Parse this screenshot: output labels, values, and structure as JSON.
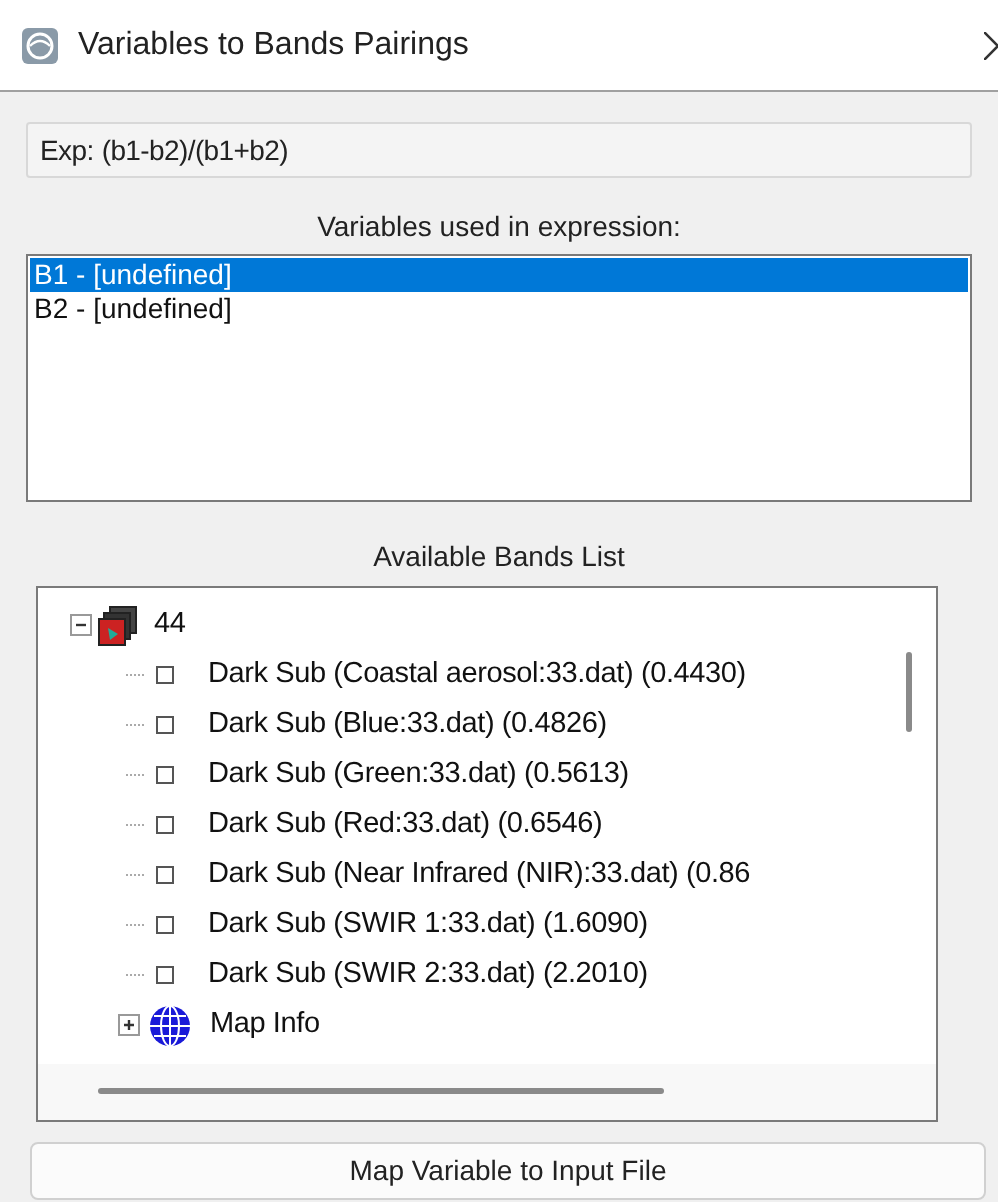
{
  "window": {
    "title": "Variables to Bands Pairings"
  },
  "expression": {
    "label": "Exp:",
    "value": "(b1-b2)/(b1+b2)"
  },
  "variables": {
    "label": "Variables used in expression:",
    "items": [
      {
        "text": "B1 - [undefined]",
        "selected": true
      },
      {
        "text": "B2 - [undefined]",
        "selected": false
      }
    ]
  },
  "bands": {
    "label": "Available Bands List",
    "tree": [
      {
        "text": "44",
        "kind": "file",
        "expanded": true,
        "children": [
          {
            "text": "Dark Sub (Coastal aerosol:33.dat) (0.4430)",
            "kind": "band"
          },
          {
            "text": "Dark Sub (Blue:33.dat) (0.4826)",
            "kind": "band"
          },
          {
            "text": "Dark Sub (Green:33.dat) (0.5613)",
            "kind": "band"
          },
          {
            "text": "Dark Sub (Red:33.dat) (0.6546)",
            "kind": "band"
          },
          {
            "text": "Dark Sub (Near Infrared (NIR):33.dat) (0.86",
            "kind": "band"
          },
          {
            "text": "Dark Sub (SWIR 1:33.dat) (1.6090)",
            "kind": "band"
          },
          {
            "text": "Dark Sub (SWIR 2:33.dat) (2.2010)",
            "kind": "band"
          },
          {
            "text": "Map Info",
            "kind": "mapinfo",
            "expanded": false
          }
        ]
      }
    ]
  },
  "button": "Map Variable to Input File"
}
